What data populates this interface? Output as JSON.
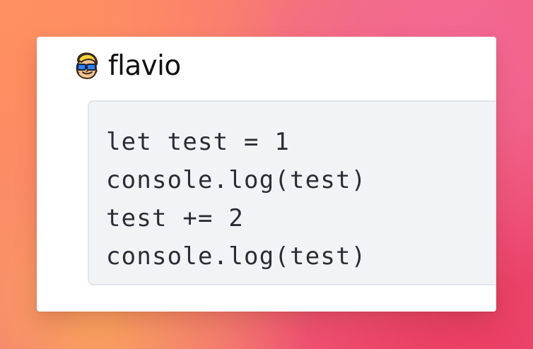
{
  "brand": {
    "avatar_icon": "cartoon-person-with-sunglasses-icon",
    "name": "flavio"
  },
  "code": {
    "lines": [
      "let test = 1",
      "console.log(test)",
      "test += 2",
      "console.log(test)"
    ]
  },
  "colors": {
    "background_gradient": [
      "#ff8f62",
      "#f26b7f",
      "#ef4e72"
    ],
    "card": "#ffffff",
    "code_background": "#f2f3f5",
    "code_border": "#e1e4e8",
    "code_text": "#2a2d33",
    "brand_text": "#111111"
  }
}
